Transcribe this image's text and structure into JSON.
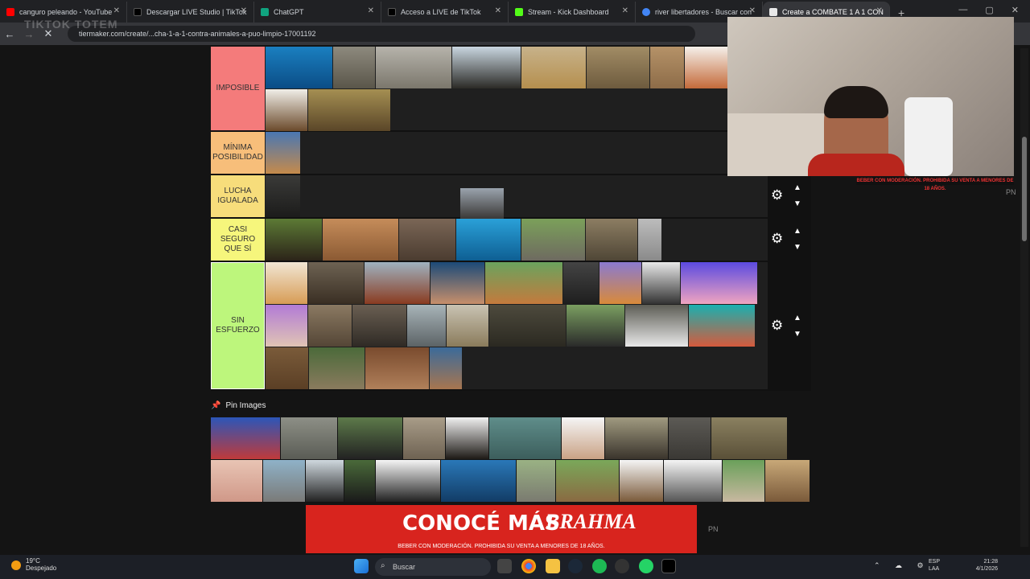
{
  "tabs": [
    {
      "title": "canguro peleando - YouTube",
      "color": "#ff0000"
    },
    {
      "title": "Descargar LIVE Studio | TikTok",
      "color": "#111111"
    },
    {
      "title": "ChatGPT",
      "color": "#10a37f"
    },
    {
      "title": "Acceso a LIVE de TikTok",
      "color": "#111111"
    },
    {
      "title": "Stream - Kick Dashboard",
      "color": "#53fc18"
    },
    {
      "title": "river libertadores - Buscar con",
      "color": "#4285f4"
    },
    {
      "title": "Create a COMBATE 1 A 1 CON",
      "color": "#e8e8e8"
    }
  ],
  "url": "tiermaker.com/create/...cha-1-a-1-contra-animales-a-puo-limpio-17001192",
  "overlay_text": "TIKTOK TOTEM",
  "tiers": [
    {
      "label": "IMPOSIBLE",
      "color": "#f47b7b"
    },
    {
      "label": "MÍNIMA POSIBILIDAD",
      "color": "#f7be7a"
    },
    {
      "label": "LUCHA IGUALADA",
      "color": "#f7dd7b"
    },
    {
      "label": "CASI SEGURO QUE SÍ",
      "color": "#f6f67c"
    },
    {
      "label": "SIN ESFUERZO",
      "color": "#bdf67c"
    }
  ],
  "pin_images_label": "Pin Images",
  "cam_banner": "BEBER CON MODERACIÓN. PROHIBIDA SU VENTA A MENORES DE 18 AÑOS.",
  "pn_label": "PN",
  "ad": {
    "main": "CONOCÉ MÁS",
    "brand": "BRAHMA",
    "disclaimer": "BEBER CON MODERACIÓN. PROHIBIDA SU VENTA A MENORES DE 18 AÑOS."
  },
  "taskbar": {
    "temp": "19°C",
    "weather": "Despejado",
    "search_placeholder": "Buscar",
    "lang": "ESP",
    "lang_sub": "LAA",
    "time": "21:28",
    "date": "4/1/2026"
  }
}
